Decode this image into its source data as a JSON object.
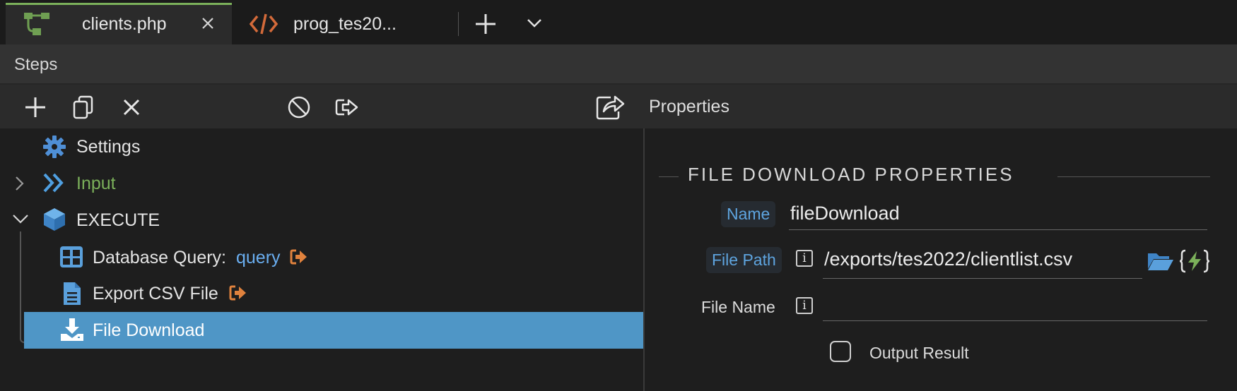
{
  "tabs": [
    {
      "label": "clients.php",
      "icon": "flow-icon",
      "active": true
    },
    {
      "label": "prog_tes20...",
      "icon": "code-icon",
      "active": false
    }
  ],
  "steps_panel": {
    "title": "Steps"
  },
  "properties_panel": {
    "title": "Properties"
  },
  "tree": {
    "settings": "Settings",
    "input": "Input",
    "execute": "EXECUTE",
    "db_query": {
      "label": "Database Query:",
      "value": "query"
    },
    "export_csv": "Export CSV File",
    "file_download": "File Download"
  },
  "section": {
    "title": "FILE DOWNLOAD PROPERTIES"
  },
  "fields": {
    "name": {
      "label": "Name",
      "value": "fileDownload"
    },
    "file_path": {
      "label": "File Path",
      "value": "/exports/tes2022/clientlist.csv"
    },
    "file_name": {
      "label": "File Name",
      "value": ""
    },
    "output_result": {
      "label": "Output Result",
      "checked": false
    }
  },
  "colors": {
    "accent_green": "#7bb05a",
    "selection_blue": "#4f96c6",
    "badge_text": "#5ea4df",
    "link_blue": "#6aaef0",
    "orange": "#e0823d",
    "info_i": "i"
  }
}
